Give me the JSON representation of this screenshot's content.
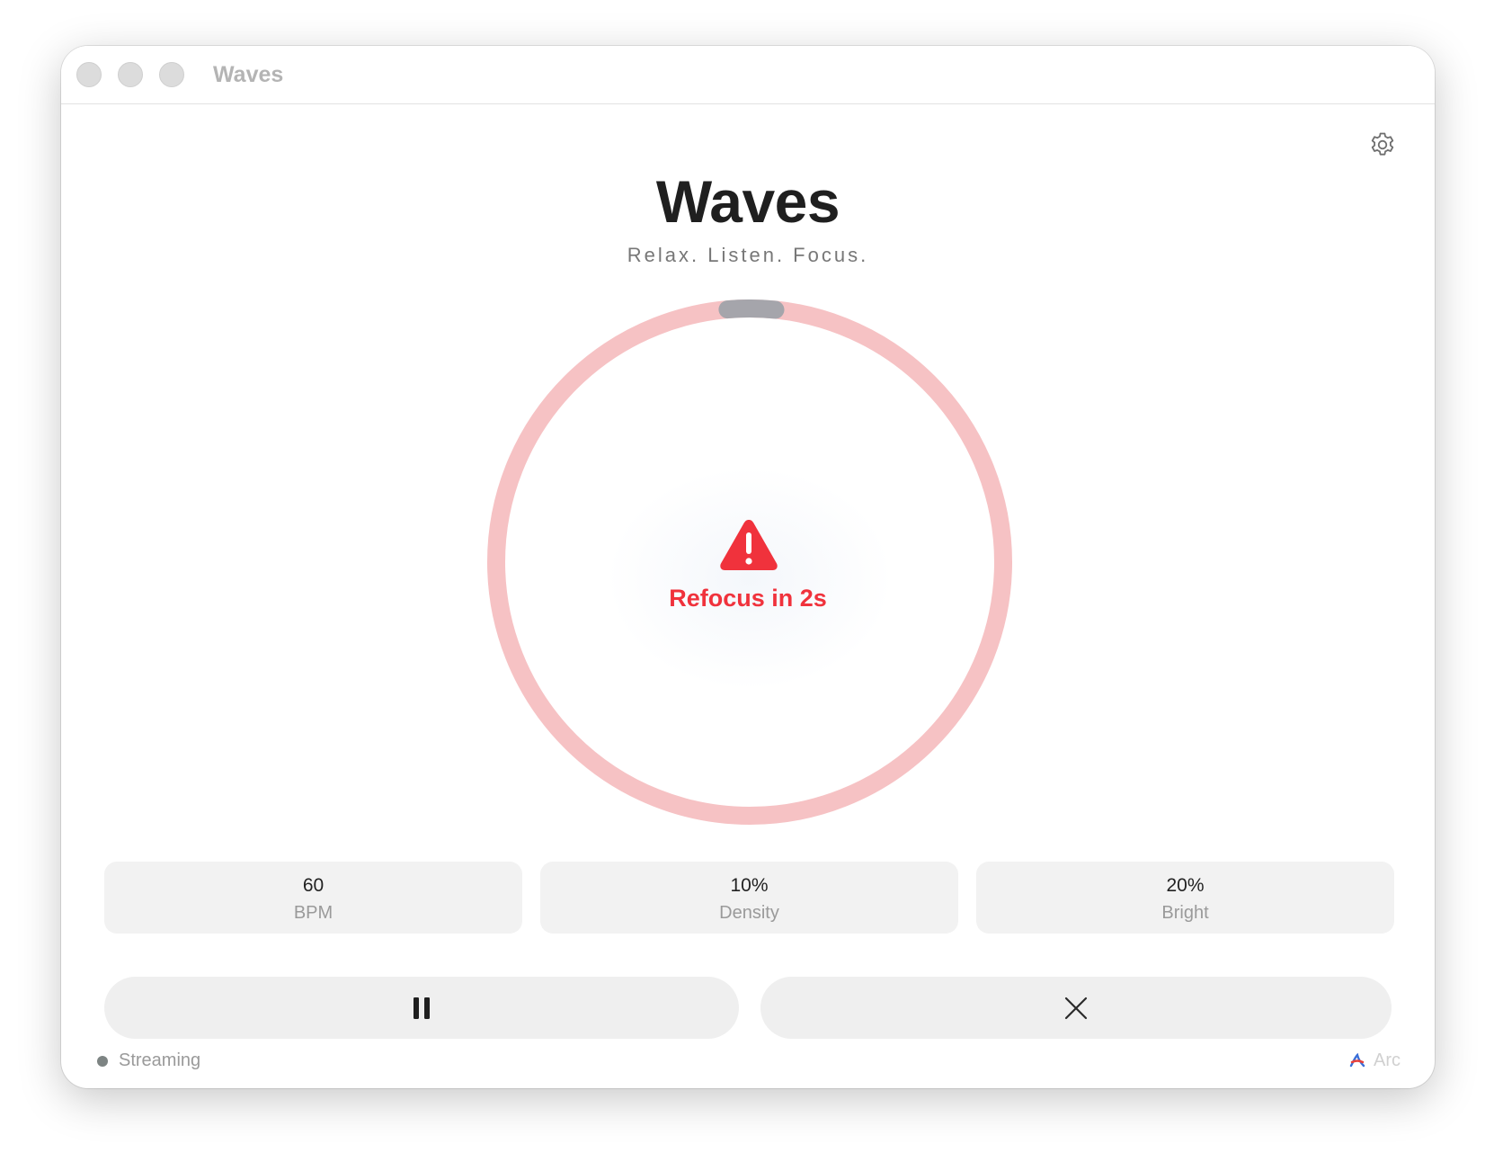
{
  "window": {
    "title": "Waves"
  },
  "header": {
    "title": "Waves",
    "tagline": "Relax. Listen. Focus."
  },
  "session": {
    "alert_text": "Refocus in 2s",
    "alert_icon": "warning-triangle-icon",
    "ring_progress": 0.03,
    "ring_color": "#f6c2c4",
    "progress_color": "#a5a5ab",
    "alert_color": "#f0323c"
  },
  "stats": [
    {
      "value": "60",
      "label": "BPM"
    },
    {
      "value": "10%",
      "label": "Density"
    },
    {
      "value": "20%",
      "label": "Bright"
    }
  ],
  "controls": {
    "pause_icon": "pause-icon",
    "stop_icon": "close-icon"
  },
  "footer": {
    "status": "Streaming",
    "status_color": "#7d8483",
    "source": "Arc",
    "source_icon": "arc-icon"
  },
  "toolbar": {
    "settings_icon": "gear-icon"
  }
}
